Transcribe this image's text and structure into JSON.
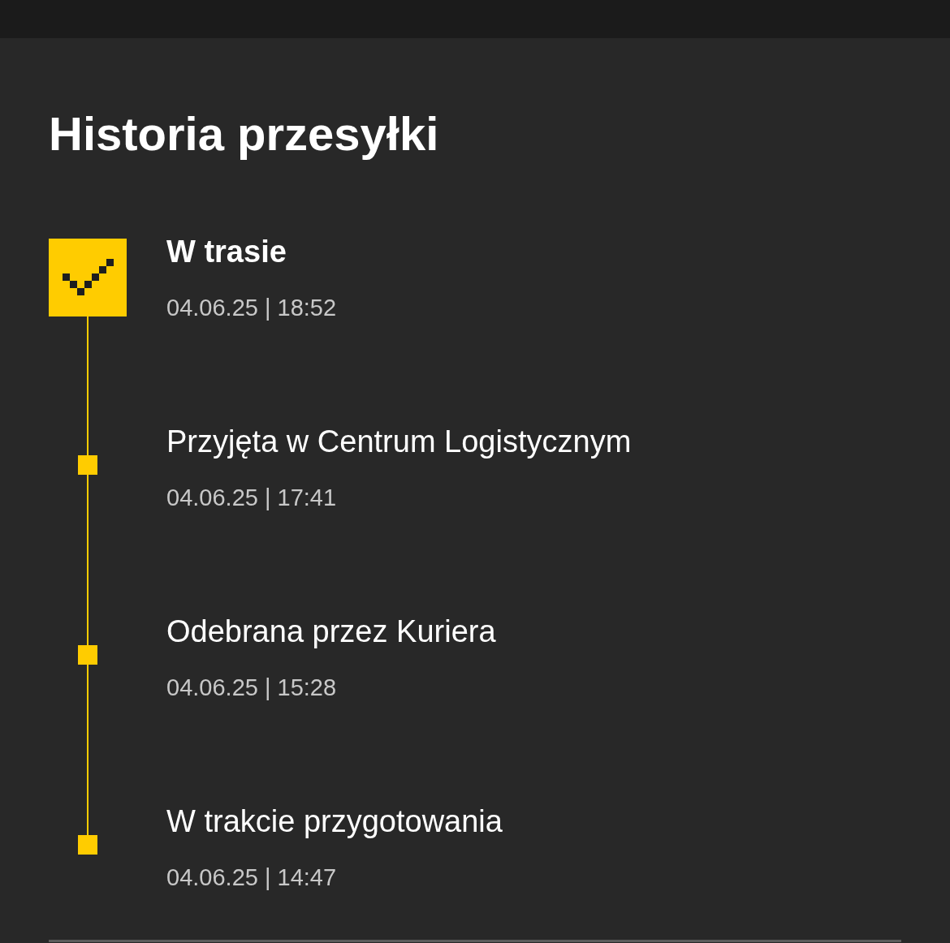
{
  "title": "Historia przesyłki",
  "events": [
    {
      "kind": "current",
      "status": "W trasie",
      "time": "04.06.25 | 18:52"
    },
    {
      "kind": "past",
      "status": "Przyjęta w Centrum Logistycznym",
      "time": "04.06.25 | 17:41"
    },
    {
      "kind": "past",
      "status": "Odebrana przez Kuriera",
      "time": "04.06.25 | 15:28"
    },
    {
      "kind": "past",
      "status": "W trakcie przygotowania",
      "time": "04.06.25 | 14:47"
    }
  ]
}
